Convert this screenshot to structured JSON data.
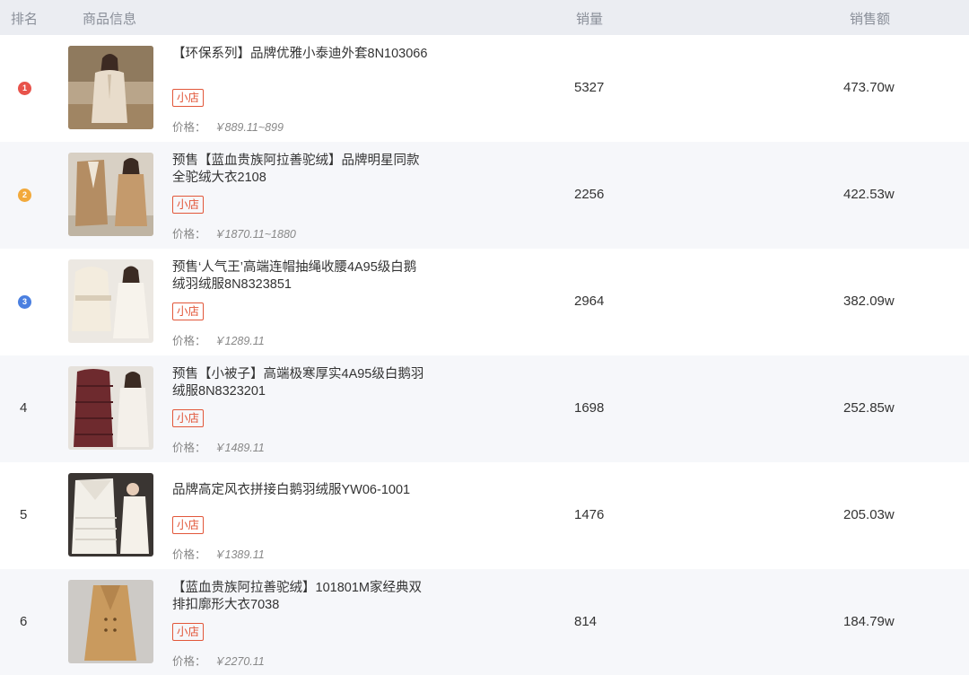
{
  "header": {
    "rank": "排名",
    "product": "商品信息",
    "sales": "销量",
    "revenue": "销售额"
  },
  "colors": {
    "medal_1": "#e8534b",
    "medal_2": "#f2a93b",
    "medal_3": "#4a7fe0",
    "badge": "#e2573a",
    "header_bg": "#ebedf2"
  },
  "rows": [
    {
      "rank": "1",
      "medal": "1",
      "image_icon": "beige-teddy-coat-photo",
      "title": "【环保系列】品牌优雅小泰迪外套8N103066",
      "badge": "小店",
      "price_label": "价格：",
      "price": "￥889.11~899",
      "sales": "5327",
      "revenue": "473.70w"
    },
    {
      "rank": "2",
      "medal": "2",
      "image_icon": "camel-coat-photo",
      "title": "预售【蓝血贵族阿拉善驼绒】品牌明星同款全驼绒大衣2108",
      "badge": "小店",
      "price_label": "价格：",
      "price": "￥1870.11~1880",
      "sales": "2256",
      "revenue": "422.53w"
    },
    {
      "rank": "3",
      "medal": "3",
      "image_icon": "cream-down-jacket-photo",
      "title": "预售‘人气王’高端连帽抽绳收腰4A95级白鹅绒羽绒服8N8323851",
      "badge": "小店",
      "price_label": "价格：",
      "price": "￥1289.11",
      "sales": "2964",
      "revenue": "382.09w"
    },
    {
      "rank": "4",
      "medal": "",
      "image_icon": "burgundy-down-coat-photo",
      "title": "预售【小被子】高端极寒厚实4A95级白鹅羽绒服8N8323201",
      "badge": "小店",
      "price_label": "价格：",
      "price": "￥1489.11",
      "sales": "1698",
      "revenue": "252.85w"
    },
    {
      "rank": "5",
      "medal": "",
      "image_icon": "white-trench-down-photo",
      "title": "品牌高定风衣拼接白鹅羽绒服YW06-1001",
      "badge": "小店",
      "price_label": "价格：",
      "price": "￥1389.11",
      "sales": "1476",
      "revenue": "205.03w"
    },
    {
      "rank": "6",
      "medal": "",
      "image_icon": "camel-double-breasted-coat-photo",
      "title": "【蓝血贵族阿拉善驼绒】101801M家经典双排扣廓形大衣7038",
      "badge": "小店",
      "price_label": "价格：",
      "price": "￥2270.11",
      "sales": "814",
      "revenue": "184.79w"
    }
  ]
}
